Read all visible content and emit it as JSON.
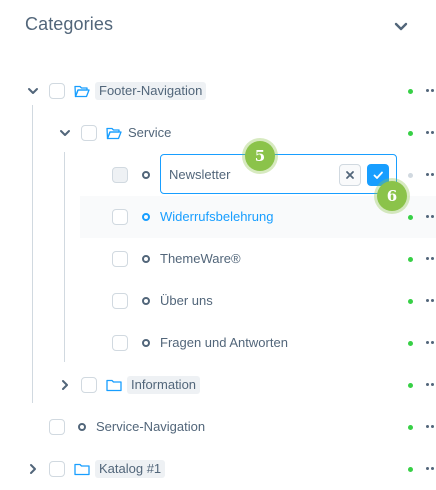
{
  "panel": {
    "title": "Categories",
    "collapse_icon": "chevron-down-icon"
  },
  "tree": {
    "footer_navigation": "Footer-Navigation",
    "service": "Service",
    "edit_value": "Newsletter",
    "widerruf": "Widerrufsbelehrung",
    "themeware": "ThemeWare®",
    "ueber_uns": "Über uns",
    "faq": "Fragen und Antworten",
    "information": "Information",
    "service_navigation": "Service-Navigation",
    "katalog": "Katalog #1"
  },
  "annotations": {
    "step_input": "5",
    "step_confirm": "6"
  },
  "colors": {
    "accent": "#189eff",
    "active_status": "#37d046",
    "inactive_status": "#d1d9e0",
    "annotation": "#8bc34a"
  }
}
